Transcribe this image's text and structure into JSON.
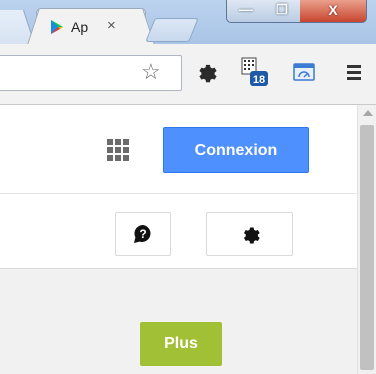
{
  "tab": {
    "title": "Ap",
    "close_glyph": "×",
    "favicon": "google-play-icon"
  },
  "window": {
    "minimize_glyph": "—",
    "maximize_glyph": "❐",
    "close_glyph": "X"
  },
  "toolbar": {
    "bookmark_icon": "star-outline-icon",
    "extension1_icon": "gear-icon",
    "extension2_icon": "calendar-badge-icon",
    "extension2_badge": "18",
    "extension3_icon": "cast-icon",
    "menu_icon": "hamburger-menu-icon"
  },
  "header": {
    "apps_icon": "apps-grid-icon",
    "signin_label": "Connexion"
  },
  "actions": {
    "help_icon": "help-icon",
    "settings_icon": "gear-icon"
  },
  "content": {
    "more_label": "Plus"
  },
  "colors": {
    "signin_blue": "#4d90fe",
    "plus_green": "#a2c035",
    "play_green": "#00c853"
  }
}
